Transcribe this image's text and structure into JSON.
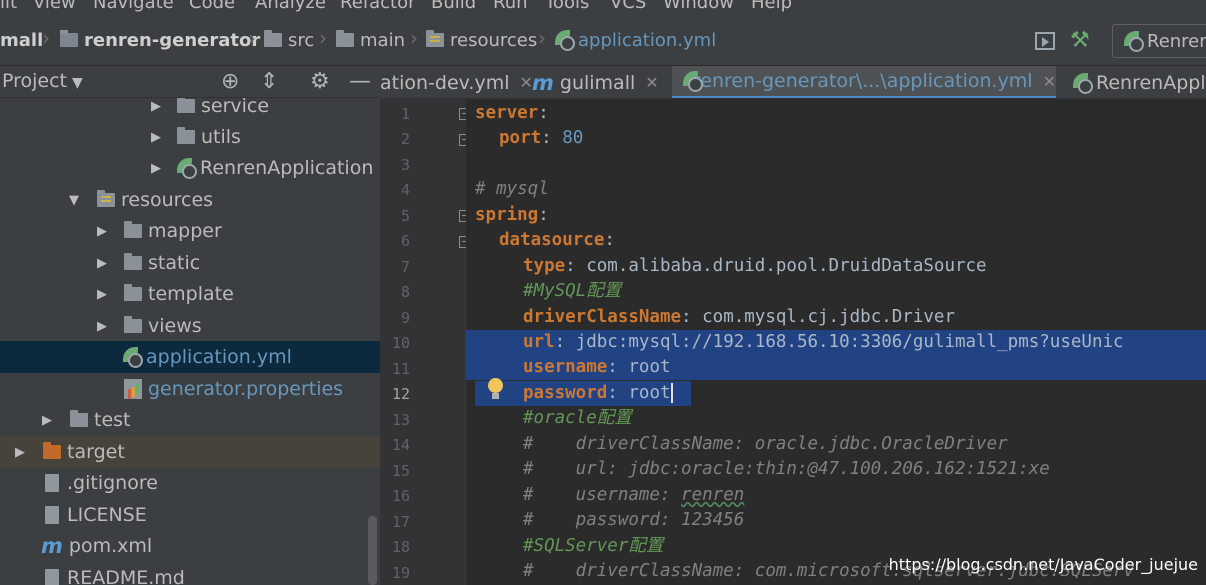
{
  "menu": [
    "lit",
    "View",
    "Navigate",
    "Code",
    "Analyze",
    "Refactor",
    "Build",
    "Run",
    "Tools",
    "VCS",
    "Window",
    "Help"
  ],
  "breadcrumb": {
    "project": "mall",
    "module": "renren-generator",
    "src": "src",
    "main": "main",
    "resources": "resources",
    "file": "application.yml"
  },
  "run_config": "Renren",
  "project_panel": {
    "title": "Project"
  },
  "tree": [
    {
      "label": "service"
    },
    {
      "label": "utils"
    },
    {
      "label": "RenrenApplication"
    },
    {
      "label": "resources"
    },
    {
      "label": "mapper"
    },
    {
      "label": "static"
    },
    {
      "label": "template"
    },
    {
      "label": "views"
    },
    {
      "label": "application.yml"
    },
    {
      "label": "generator.properties"
    },
    {
      "label": "test"
    },
    {
      "label": "target"
    },
    {
      "label": ".gitignore"
    },
    {
      "label": "LICENSE"
    },
    {
      "label": "pom.xml"
    },
    {
      "label": "README.md"
    }
  ],
  "tabs": [
    {
      "label": "ation-dev.yml"
    },
    {
      "label": "gulimall"
    },
    {
      "label": "renren-generator\\...\\application.yml"
    },
    {
      "label": "RenrenAppli"
    }
  ],
  "line_numbers": [
    "1",
    "2",
    "3",
    "4",
    "5",
    "6",
    "7",
    "8",
    "9",
    "10",
    "11",
    "12",
    "13",
    "14",
    "15",
    "16",
    "17",
    "18",
    "19"
  ],
  "code": {
    "l1": {
      "key": "server",
      "colon": ":"
    },
    "l2": {
      "key": "port",
      "colon": ": ",
      "value": "80"
    },
    "l4": {
      "comment": "# mysql"
    },
    "l5": {
      "key": "spring",
      "colon": ":"
    },
    "l6": {
      "key": "datasource",
      "colon": ":"
    },
    "l7": {
      "key": "type",
      "colon": ": ",
      "value": "com.alibaba.druid.pool.DruidDataSource"
    },
    "l8": {
      "comment": "#MySQL配置"
    },
    "l9": {
      "key": "driverClassName",
      "colon": ": ",
      "value": "com.mysql.cj.jdbc.Driver"
    },
    "l10": {
      "key": "url",
      "colon": ": ",
      "value": "jdbc:mysql://192.168.56.10:3306/gulimall_pms?useUnic"
    },
    "l11": {
      "key": "username",
      "colon": ": ",
      "value": "root"
    },
    "l12": {
      "key": "password",
      "colon": ": ",
      "value": "root"
    },
    "l13": {
      "comment": "#oracle配置"
    },
    "l14": {
      "comment": "#    driverClassName: oracle.jdbc.OracleDriver"
    },
    "l15": {
      "comment": "#    url: jdbc:oracle:thin:@47.100.206.162:1521:xe"
    },
    "l16": {
      "prefix": "#    username: ",
      "squig": "renren"
    },
    "l17": {
      "comment": "#    password: 123456"
    },
    "l18": {
      "comment": "#SQLServer配置"
    },
    "l19": {
      "comment": "#    driverClassName: com.microsoft.sqlserver.jdbc.SQLServ"
    }
  },
  "watermark": "https://blog.csdn.net/JavaCoder_juejue",
  "colors": {
    "selection": "#214283",
    "key": "#cc7832",
    "comment": "#629755",
    "number": "#6897bb",
    "tab_underline": "#4a88c7"
  }
}
